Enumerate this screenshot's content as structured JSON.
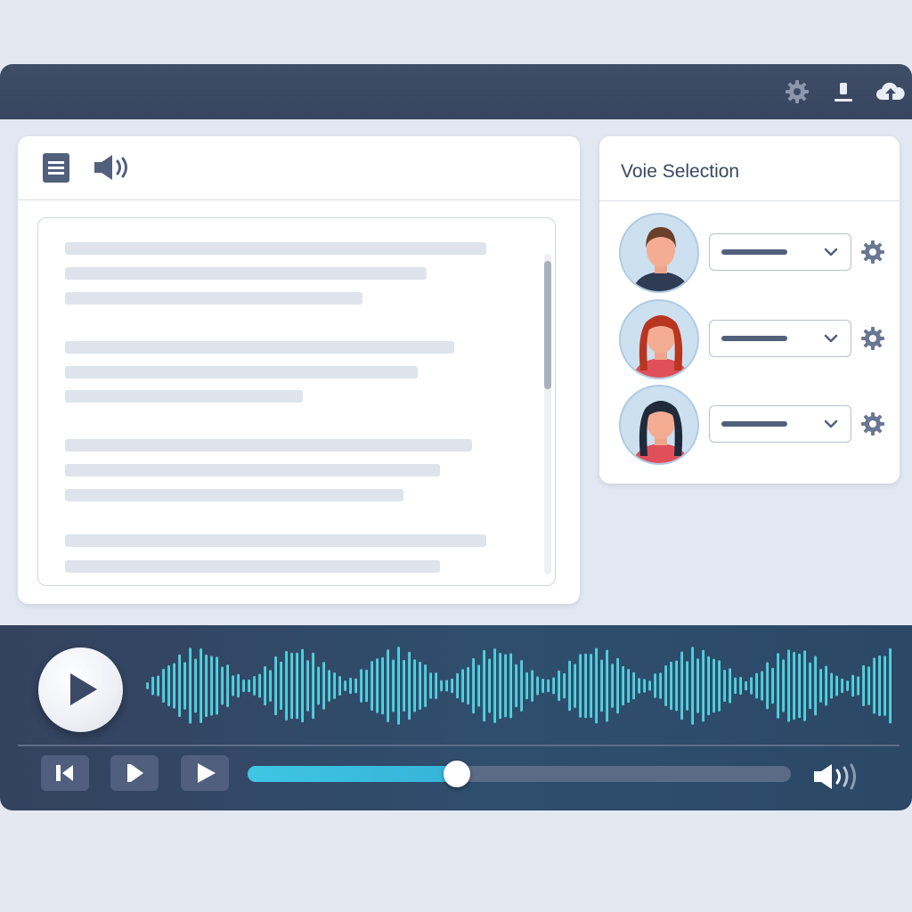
{
  "window": {
    "toolbar_icons": [
      "gear-icon",
      "download-icon",
      "cloud-upload-icon"
    ]
  },
  "editor": {
    "toolbar_icons": [
      "document-icon",
      "speaker-icon"
    ],
    "text_placeholder_lines": [
      {
        "fraction": 0.92
      },
      {
        "fraction": 0.79
      },
      {
        "fraction": 0.65
      },
      {
        "fraction": 0.85
      },
      {
        "fraction": 0.77
      },
      {
        "fraction": 0.52
      },
      {
        "fraction": 0.89
      },
      {
        "fraction": 0.82
      },
      {
        "fraction": 0.74
      },
      {
        "fraction": 0.92
      },
      {
        "fraction": 0.82
      }
    ],
    "scroll_position": 0.05
  },
  "voice_panel": {
    "title": "Voie Selection",
    "voices": [
      {
        "avatar": "male-avatar",
        "hair_color": "#6b3f2a",
        "shirt_color": "#2e3b52"
      },
      {
        "avatar": "female-avatar-red-hair",
        "hair_color": "#b8351f",
        "shirt_color": "#e0505a"
      },
      {
        "avatar": "female-avatar-black-hair",
        "hair_color": "#1f2a3a",
        "shirt_color": "#e0505a"
      }
    ]
  },
  "player": {
    "progress": 0.385,
    "controls": [
      "skip-back-icon",
      "step-play-icon",
      "play-icon"
    ],
    "colors": {
      "wave_start": "#3fb8e8",
      "wave_end": "#5fe0c8",
      "progress": "#3ec6e3"
    }
  }
}
